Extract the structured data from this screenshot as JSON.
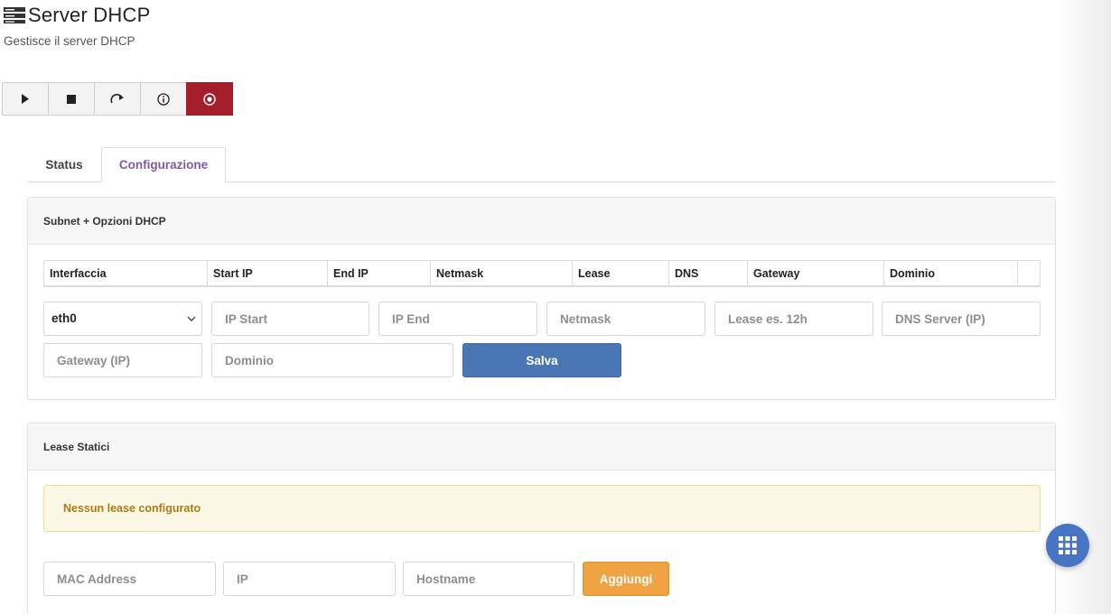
{
  "header": {
    "title": "Server DHCP",
    "subtitle": "Gestisce il server DHCP",
    "icon": "server-icon"
  },
  "controls": [
    {
      "name": "start-button",
      "icon": "play-icon"
    },
    {
      "name": "stop-button",
      "icon": "stop-icon"
    },
    {
      "name": "restart-button",
      "icon": "restart-icon"
    },
    {
      "name": "info-button",
      "icon": "info-icon"
    },
    {
      "name": "disable-button",
      "icon": "stop-circle-icon"
    }
  ],
  "colors": {
    "danger": "#a31d2b",
    "primary": "#4a77b4",
    "warning": "#f0a343",
    "tab_active": "#7d5aa6",
    "fab": "#4875c1"
  },
  "tabs": [
    {
      "label": "Status",
      "active": false
    },
    {
      "label": "Configurazione",
      "active": true
    }
  ],
  "dhcp_panel": {
    "title": "Subnet + Opzioni DHCP",
    "columns": [
      "Interfaccia",
      "Start IP",
      "End IP",
      "Netmask",
      "Lease",
      "DNS",
      "Gateway",
      "Dominio"
    ],
    "interface_value": "eth0",
    "placeholders": {
      "ip_start": "IP Start",
      "ip_end": "IP End",
      "netmask": "Netmask",
      "lease": "Lease es. 12h",
      "dns": "DNS Server (IP)",
      "gateway": "Gateway (IP)",
      "domain": "Dominio"
    },
    "save_label": "Salva"
  },
  "lease_panel": {
    "title": "Lease Statici",
    "empty_message": "Nessun lease configurato",
    "placeholders": {
      "mac": "MAC Address",
      "ip": "IP",
      "hostname": "Hostname"
    },
    "add_label": "Aggiungi"
  },
  "fab_icon": "apps-grid-icon"
}
